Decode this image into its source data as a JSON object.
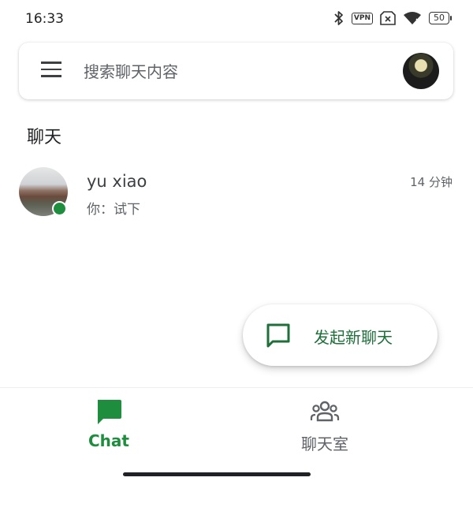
{
  "status_bar": {
    "time": "16:33",
    "vpn_label": "VPN",
    "battery": "50",
    "icons": [
      "bluetooth-icon",
      "vpn-icon",
      "no-sim-icon",
      "wifi-icon",
      "battery-icon"
    ]
  },
  "search": {
    "placeholder": "搜索聊天内容"
  },
  "section": {
    "title": "聊天"
  },
  "chats": [
    {
      "name": "yu xiao",
      "preview": "你：试下",
      "time": "14 分钟",
      "online": true
    }
  ],
  "fab": {
    "label": "发起新聊天"
  },
  "bottom_nav": {
    "chat_label": "Chat",
    "rooms_label": "聊天室"
  },
  "colors": {
    "accent": "#1e8e3e",
    "fab_text": "#1e6f3a",
    "text_primary": "#202124",
    "text_secondary": "#5f6368"
  }
}
